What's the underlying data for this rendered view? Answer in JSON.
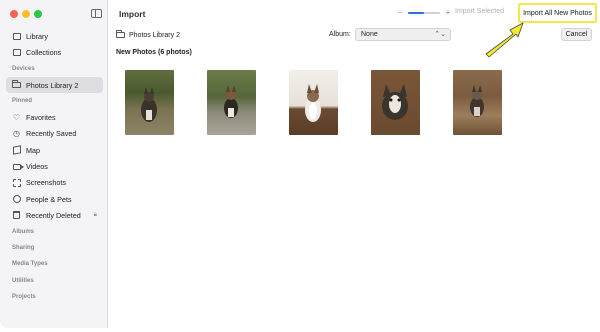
{
  "window": {
    "sidebar": {
      "items": [
        {
          "label": "Library",
          "icon": "library-icon"
        },
        {
          "label": "Collections",
          "icon": "collections-icon"
        }
      ],
      "sections": {
        "devices": "Devices",
        "pinned": "Pinned",
        "albums": "Albums",
        "sharing": "Sharing",
        "media_types": "Media Types",
        "utilities": "Utilities",
        "projects": "Projects"
      },
      "devices": [
        {
          "label": "Photos Library 2",
          "icon": "folder-icon",
          "selected": true
        }
      ],
      "pinned": [
        {
          "label": "Favorites",
          "icon": "heart-icon"
        },
        {
          "label": "Recently Saved",
          "icon": "clock-icon"
        },
        {
          "label": "Map",
          "icon": "map-icon"
        },
        {
          "label": "Videos",
          "icon": "video-icon"
        },
        {
          "label": "Screenshots",
          "icon": "screenshot-icon"
        },
        {
          "label": "People & Pets",
          "icon": "person-icon"
        },
        {
          "label": "Recently Deleted",
          "icon": "trash-icon",
          "locked": true
        }
      ]
    },
    "toolbar": {
      "title": "Import",
      "zoom_minus": "−",
      "zoom_plus": "+",
      "zoom_level": 0.5,
      "import_selected": "Import Selected",
      "import_all": "Import All New Photos"
    },
    "content": {
      "library_name": "Photos Library 2",
      "album_label": "Album:",
      "album_value": "None",
      "cancel": "Cancel",
      "section_title": "New Photos (6 photos)"
    },
    "colors": {
      "accent": "#2f6fe0",
      "highlight": "#f5e64b",
      "sidebar_bg": "#f4f4f6"
    }
  }
}
